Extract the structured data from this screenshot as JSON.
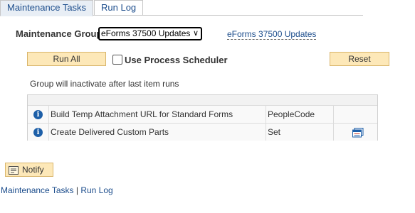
{
  "tabs": [
    "Maintenance Tasks",
    "Run Log"
  ],
  "maintenance_group": {
    "label": "Maintenance Group",
    "selected": "eForms 37500 Updates",
    "description": "eForms 37500 Updates"
  },
  "buttons": {
    "run_all": "Run All",
    "reset": "Reset",
    "notify": "Notify"
  },
  "use_process_scheduler": {
    "label": "Use Process Scheduler",
    "checked": false
  },
  "note": "Group will inactivate after last item runs",
  "tasks": [
    {
      "description": "Build Temp Attachment URL for Standard Forms",
      "type": "PeopleCode",
      "icon": "info-icon"
    },
    {
      "description": "Create Delivered Custom Parts",
      "type": "Set",
      "icon": "info-icon",
      "action_icon": "detail-grid-icon"
    }
  ],
  "footer": {
    "link1": "Maintenance Tasks",
    "separator": "|",
    "link2": "Run Log"
  },
  "colors": {
    "link": "#1c4d8c",
    "button_bg": "#fde8b8",
    "info_icon": "#1d5fa8"
  }
}
